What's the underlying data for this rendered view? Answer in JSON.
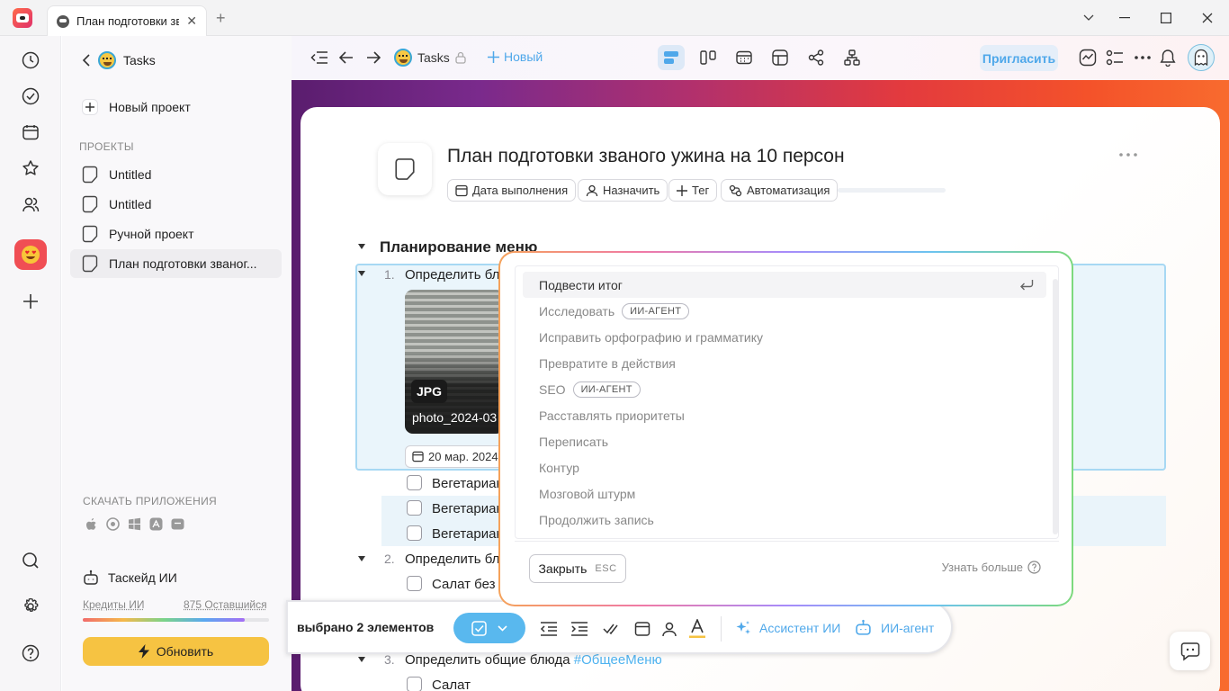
{
  "window": {
    "tab_title": "План подготовки зва...",
    "tab_close": "✕",
    "new_tab": "+"
  },
  "sidebar": {
    "back_title": "Tasks",
    "new_project": "Новый проект",
    "section_label": "ПРОЕКТЫ",
    "projects": [
      "Untitled",
      "Untitled",
      "Ручной проект",
      "План подготовки званог..."
    ],
    "download_label": "СКАЧАТЬ ПРИЛОЖЕНИЯ",
    "ai_title": "Таскейд ИИ",
    "credits_label": "Кредиты ИИ",
    "credits_remaining": "875 Оставшийся",
    "credits_fraction": 0.87,
    "upgrade_label": "Обновить"
  },
  "toolbar": {
    "workspace": "Tasks",
    "new_label": "Новый",
    "invite_label": "Пригласить"
  },
  "document": {
    "title": "План подготовки званого ужина на 10 персон",
    "pills": [
      "Дата выполнения",
      "Назначить",
      "Тег",
      "Автоматизация"
    ],
    "section_title": "Планирование меню",
    "items": [
      {
        "num": "1.",
        "text": "Определить бл"
      },
      {
        "num": "2.",
        "text": "Определить бл"
      },
      {
        "num": "3.",
        "text": "Определить общие блюда ",
        "tag": "#ОбщееМеню"
      }
    ],
    "attachment": {
      "type": "JPG",
      "name": "photo_2024-03"
    },
    "date_chip": "20 мар. 2024",
    "subitems_1": [
      "Вегетариан",
      "Вегетариан",
      "Вегетариан"
    ],
    "subitems_2": [
      "Салат без а"
    ],
    "subitems_3": [
      "Салат"
    ]
  },
  "ai_menu": {
    "items": [
      {
        "label": "Подвести итог",
        "badge": ""
      },
      {
        "label": "Исследовать",
        "badge": "ИИ-АГЕНТ"
      },
      {
        "label": "Исправить орфографию и грамматику",
        "badge": ""
      },
      {
        "label": "Превратите в действия",
        "badge": ""
      },
      {
        "label": "SEO",
        "badge": "ИИ-АГЕНТ"
      },
      {
        "label": "Расставлять приоритеты",
        "badge": ""
      },
      {
        "label": "Переписать",
        "badge": ""
      },
      {
        "label": "Контур",
        "badge": ""
      },
      {
        "label": "Мозговой штурм",
        "badge": ""
      },
      {
        "label": "Продолжить запись",
        "badge": ""
      }
    ],
    "close_label": "Закрыть",
    "esc_label": "ESC",
    "learn_more": "Узнать больше"
  },
  "action_bar": {
    "selected_text": "выбрано 2 элементов",
    "assistant_label": "Ассистент ИИ",
    "agent_label": "ИИ-агент"
  },
  "colors": {
    "accent_blue": "#4fb3f0",
    "brand_red": "#f04e54",
    "upgrade_yellow": "#f6c342"
  }
}
